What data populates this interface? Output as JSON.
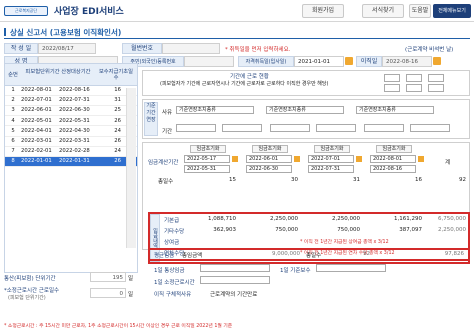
{
  "header": {
    "logo_text": "근로복지공단",
    "app_title": "사업장 EDI서비스",
    "join": "회원가입",
    "guide": "서식찾기",
    "help": "도움말",
    "menu": "전체메뉴보기"
  },
  "page": {
    "title": "상실 신고서 (고용보험 이직확인서)"
  },
  "form": {
    "written_date_label": "작 성 일",
    "written_date": "2022/08/17",
    "worker_no_label": "월번번호",
    "worker_no": "",
    "required_note": "* 취득일을 먼저 입력하세요.",
    "right_note": "(근로계약 비석번 날)",
    "name_label": "성 명",
    "name": "",
    "id_label": "주민(외국인)등록번호",
    "id": "",
    "acq_label": "자격취득일(입사일)",
    "acq_date": "2021-01-01",
    "leave_label": "이직일",
    "leave_date": "2022-08-16"
  },
  "list": {
    "headers": [
      "순번",
      "피보험단위기간 산정대상기간",
      "보수지급기초일수"
    ],
    "rows": [
      {
        "no": "1",
        "from": "2022-08-01",
        "to": "2022-08-16",
        "days": "16"
      },
      {
        "no": "2",
        "from": "2022-07-01",
        "to": "2022-07-31",
        "days": "31"
      },
      {
        "no": "3",
        "from": "2022-06-01",
        "to": "2022-06-30",
        "days": "25"
      },
      {
        "no": "4",
        "from": "2022-05-01",
        "to": "2022-05-31",
        "days": "26"
      },
      {
        "no": "5",
        "from": "2022-04-01",
        "to": "2022-04-30",
        "days": "24"
      },
      {
        "no": "6",
        "from": "2022-03-01",
        "to": "2022-03-31",
        "days": "26"
      },
      {
        "no": "7",
        "from": "2022-02-01",
        "to": "2022-02-28",
        "days": "24"
      },
      {
        "no": "8",
        "from": "2022-01-01",
        "to": "2022-01-31",
        "days": "26"
      }
    ],
    "unit_label": "통산(피보험) 단위기간",
    "unit_value": "195",
    "unit_suffix": "일",
    "min_label": "*소정근로시간 근로일수",
    "min_sub": "(피보험 단위기간)",
    "min_value": "0",
    "min_suffix": "일"
  },
  "right": {
    "period_title": "기간에 근로 현황",
    "period_sub": "(피보험자가 기간에 근로자연시나 기간에 근로자로 근로하다 이직한 경우만 해당)",
    "special_label": "기준기간연장",
    "reason_label": "사유",
    "period_label": "기간",
    "select1": "기준연장조치종류",
    "select2": "기준연장조치종류",
    "select3": "기준연장조치종류",
    "wage_period_label": "임금계산기간",
    "col_from_btn": "임금초기화",
    "cols": [
      {
        "from": "2022-05-17",
        "to": "2022-05-31"
      },
      {
        "from": "2022-06-01",
        "to": "2022-06-30"
      },
      {
        "from": "2022-07-01",
        "to": "2022-07-31"
      },
      {
        "from": "2022-08-01",
        "to": "2022-08-16"
      }
    ],
    "total_col": "계",
    "days_label": "총일수",
    "days": [
      "15",
      "30",
      "31",
      "16"
    ],
    "days_total": "92",
    "wage_side_label": "임금내역",
    "rows": [
      {
        "label": "기본급",
        "values": [
          "1,088,710",
          "2,250,000",
          "2,250,000",
          "1,161,290"
        ],
        "total": "6,750,000"
      },
      {
        "label": "기타수당",
        "values": [
          "362,903",
          "750,000",
          "750,000",
          "387,097"
        ],
        "total": "2,250,000"
      },
      {
        "label": "상여금",
        "values": [],
        "note": "* 이직 전 1년간 지급된 상여금 총액 x 3/12"
      },
      {
        "label": "연차수당",
        "values": [],
        "note": "* 이직 전 1년간 지급된 연차 수당 총액 x 3/12"
      }
    ],
    "avg_label": "평균임금",
    "avg_total_label": "총임금액",
    "avg_total": "9,000,000",
    "avg_days_label": "총일수",
    "avg_days": "92",
    "avg_value": "97,826",
    "daily_label": "1일 통상임금",
    "daily_value": "",
    "basic_days_label": "1일 기준보수",
    "basic_days_value": "",
    "hours_label": "1일 소정근로시간",
    "hours_value": "",
    "reason_code_label": "이직 구체적사유",
    "reason_code_value": "근로계약의 기간만료"
  },
  "footer": {
    "text": "* 소정근로시간 : 주 15시간 미만 근로자, 1주 소정근로시간이 15시간 이상인 경우 근로 이직일 2022년 1월 기준"
  }
}
